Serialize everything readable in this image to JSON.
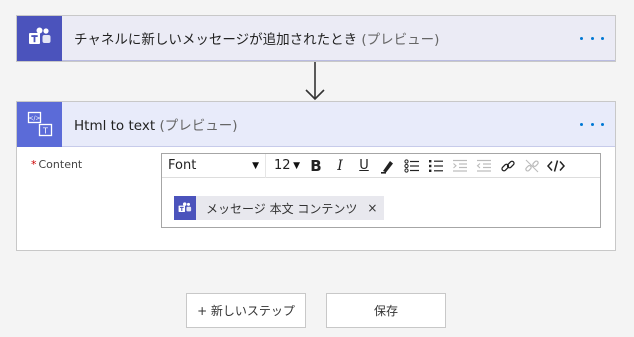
{
  "trigger": {
    "title": "チャネルに新しいメッセージが追加されたとき",
    "preview": "(プレビュー)",
    "icon": "teams-icon"
  },
  "action": {
    "title": "Html to text",
    "preview": "(プレビュー)",
    "icon": "html-to-text-icon",
    "field": {
      "required_mark": "*",
      "label": "Content"
    },
    "toolbar": {
      "font": "Font",
      "size": "12",
      "bold": "B",
      "italic": "I",
      "underline": "U"
    },
    "token": {
      "label": "メッセージ 本文 コンテンツ",
      "close": "×"
    }
  },
  "buttons": {
    "new_step": "+ 新しいステップ",
    "save": "保存"
  },
  "colors": {
    "teams": "#4b53bc",
    "html_to_text": "#5b6bd8",
    "accent": "#0078d4"
  }
}
